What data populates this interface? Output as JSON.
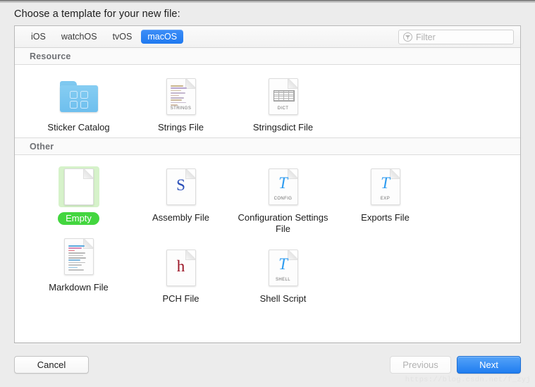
{
  "window": {
    "prompt": "Choose a template for your new file:"
  },
  "tabs": [
    {
      "label": "iOS",
      "active": false
    },
    {
      "label": "watchOS",
      "active": false
    },
    {
      "label": "tvOS",
      "active": false
    },
    {
      "label": "macOS",
      "active": true
    }
  ],
  "filter": {
    "placeholder": "Filter",
    "value": "",
    "icon": "filter-icon"
  },
  "sections": [
    {
      "title": "Resource",
      "items": [
        {
          "label": "Sticker Catalog",
          "icon": "folder-sticker-icon",
          "selected": false
        },
        {
          "label": "Strings File",
          "icon": "strings-document-icon",
          "tag": "STRINGS",
          "selected": false
        },
        {
          "label": "Stringsdict File",
          "icon": "dict-document-icon",
          "tag": "DICT",
          "selected": false
        }
      ]
    },
    {
      "title": "Other",
      "items": [
        {
          "label": "Empty",
          "icon": "blank-document-icon",
          "selected": true
        },
        {
          "label": "Assembly File",
          "icon": "assembly-document-icon",
          "glyph": "S",
          "selected": false
        },
        {
          "label": "Configuration Settings File",
          "icon": "config-document-icon",
          "glyph": "T",
          "tag": "CONFIG",
          "selected": false
        },
        {
          "label": "Exports File",
          "icon": "exports-document-icon",
          "glyph": "T",
          "tag": "EXP",
          "selected": false
        },
        {
          "label": "Markdown File",
          "icon": "markdown-document-icon",
          "selected": false
        },
        {
          "label": "PCH File",
          "icon": "pch-document-icon",
          "glyph": "h",
          "selected": false
        },
        {
          "label": "Shell Script",
          "icon": "shell-document-icon",
          "glyph": "T",
          "tag": "SHELL",
          "selected": false
        }
      ]
    }
  ],
  "footer": {
    "cancel": "Cancel",
    "previous": "Previous",
    "next": "Next"
  },
  "watermark": "https://blog.csdn.net/f_zyj",
  "colors": {
    "accent_blue": "#1f7df0",
    "selection_green": "#43d63f",
    "selection_green_light": "#d6f2ca",
    "panel_bg": "#ffffff",
    "window_bg": "#ececec"
  }
}
